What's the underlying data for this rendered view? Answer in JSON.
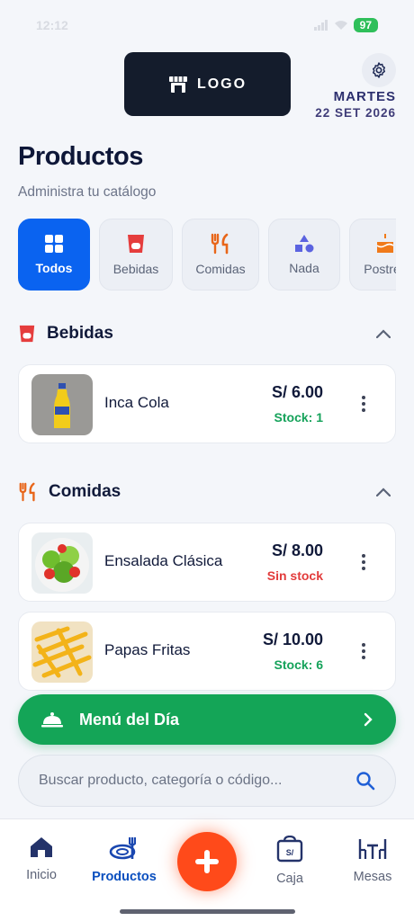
{
  "status_bar": {
    "time": "12:12",
    "battery": "97"
  },
  "header": {
    "logo_text": "LOGO",
    "weekday": "MARTES",
    "date": "22 SET 2026"
  },
  "page": {
    "title": "Productos",
    "subtitle": "Administra tu catálogo"
  },
  "categories": [
    {
      "label": "Todos",
      "icon": "grid-icon",
      "active": true
    },
    {
      "label": "Bebidas",
      "icon": "cup-icon",
      "active": false
    },
    {
      "label": "Comidas",
      "icon": "utensils-icon",
      "active": false
    },
    {
      "label": "Nada",
      "icon": "shapes-icon",
      "active": false
    },
    {
      "label": "Postres",
      "icon": "cake-icon",
      "active": false
    }
  ],
  "sections": [
    {
      "title": "Bebidas",
      "icon": "cup-icon",
      "items": [
        {
          "name": "Inca Cola",
          "price": "S/ 6.00",
          "stock": "Stock: 1",
          "stock_status": "ok"
        }
      ]
    },
    {
      "title": "Comidas",
      "icon": "utensils-icon",
      "items": [
        {
          "name": "Ensalada Clásica",
          "price": "S/ 8.00",
          "stock": "Sin stock",
          "stock_status": "none"
        },
        {
          "name": "Papas Fritas",
          "price": "S/ 10.00",
          "stock": "Stock: 6",
          "stock_status": "ok"
        }
      ]
    }
  ],
  "menu_del_dia": {
    "label": "Menú del Día"
  },
  "search": {
    "placeholder": "Buscar producto, categoría o código..."
  },
  "bottom_nav": {
    "items": [
      {
        "label": "Inicio",
        "icon": "home-icon"
      },
      {
        "label": "Productos",
        "icon": "dish-icon",
        "active": true
      },
      {
        "label": "Caja",
        "icon": "cash-bag-icon"
      },
      {
        "label": "Mesas",
        "icon": "table-icon"
      }
    ],
    "fab_icon": "plus-icon"
  },
  "colors": {
    "primary": "#0a63f0",
    "success": "#14a557",
    "danger": "#e23b3b",
    "accent_orange": "#ff4a1a",
    "navy": "#111a3a"
  }
}
